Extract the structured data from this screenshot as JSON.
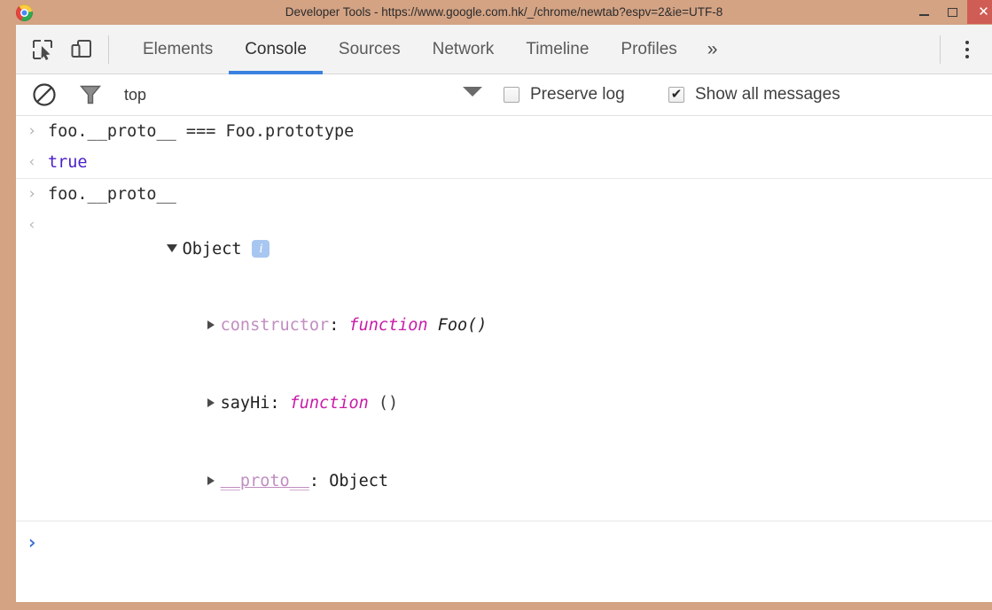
{
  "window": {
    "title": "Developer Tools - https://www.google.com.hk/_/chrome/newtab?espv=2&ie=UTF-8",
    "minimize_label": "–",
    "maximize_label": "□",
    "close_label": "✕",
    "frame_color": "#d3a384",
    "close_color": "#cf5c55"
  },
  "toolbar": {
    "inspect_icon": "inspect-element-icon",
    "device_icon": "device-toolbar-icon",
    "menu_icon": "more-options-icon",
    "overflow_label": "»"
  },
  "tabs": [
    {
      "label": "Elements",
      "active": false
    },
    {
      "label": "Console",
      "active": true
    },
    {
      "label": "Sources",
      "active": false
    },
    {
      "label": "Network",
      "active": false
    },
    {
      "label": "Timeline",
      "active": false
    },
    {
      "label": "Profiles",
      "active": false
    }
  ],
  "filterbar": {
    "clear_icon": "clear-console-icon",
    "filter_icon": "filter-funnel-icon",
    "context": "top",
    "caret_icon": "chevron-down-icon",
    "preserve_log": {
      "label": "Preserve log",
      "checked": false
    },
    "show_all_messages": {
      "label": "Show all messages",
      "checked": true
    },
    "tick_glyph": "✔"
  },
  "console": {
    "input_marker": "›",
    "output_marker": "‹",
    "prompt_marker": "›",
    "entries": [
      {
        "input": "foo.__proto__ === Foo.prototype",
        "output": "true",
        "output_color": "#4b1fc8"
      },
      {
        "input": "foo.__proto__",
        "object_label": "Object",
        "info_badge": "i",
        "properties": [
          {
            "key": "constructor",
            "sep": ": ",
            "kw": "function",
            "value": " Foo()",
            "key_style": "dim"
          },
          {
            "key": "sayHi",
            "sep": ": ",
            "kw": "function",
            "value": " ()",
            "key_style": "solid"
          },
          {
            "key": "__proto__",
            "sep": ": ",
            "kw": "",
            "value": "Object",
            "key_style": "dim-underline"
          }
        ]
      }
    ]
  }
}
